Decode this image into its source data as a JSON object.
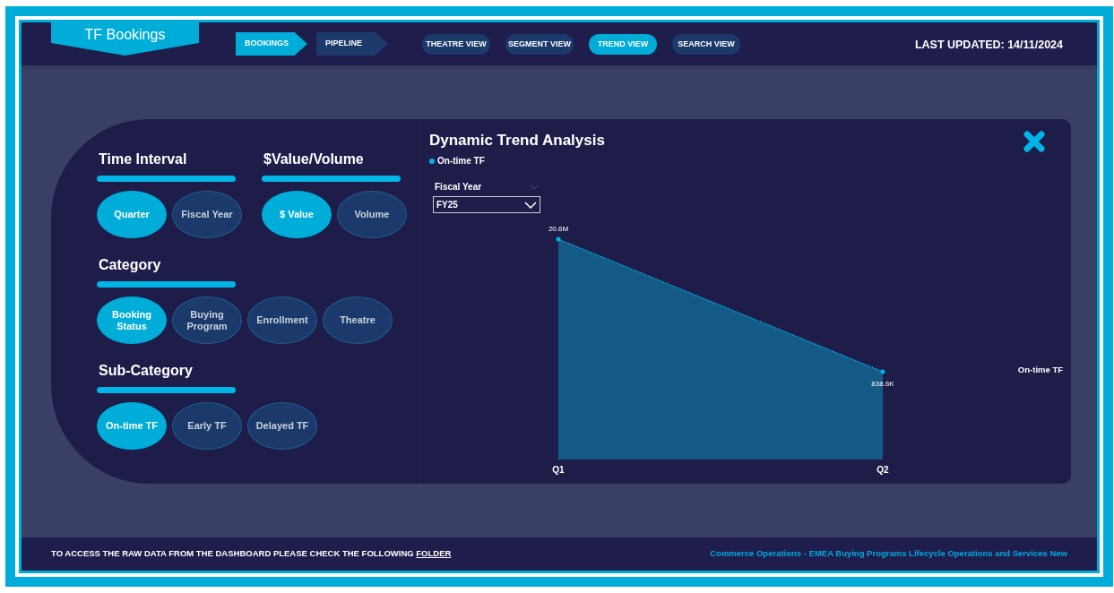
{
  "header": {
    "title": "TF Bookings",
    "nav": [
      {
        "label": "BOOKINGS",
        "selected": true
      },
      {
        "label": "PIPELINE",
        "selected": false
      }
    ],
    "views": [
      {
        "label": "THEATRE VIEW",
        "selected": false
      },
      {
        "label": "SEGMENT VIEW",
        "selected": false
      },
      {
        "label": "TREND VIEW",
        "selected": true
      },
      {
        "label": "SEARCH VIEW",
        "selected": false
      }
    ],
    "last_updated": "LAST UPDATED: 14/11/2024"
  },
  "slicers": [
    {
      "title": "Time Interval",
      "options": [
        {
          "label": "Quarter",
          "selected": true
        },
        {
          "label": "Fiscal Year",
          "selected": false
        }
      ]
    },
    {
      "title": "$Value/Volume",
      "options": [
        {
          "label": "$ Value",
          "selected": true
        },
        {
          "label": "Volume",
          "selected": false
        }
      ]
    },
    {
      "title": "Category",
      "options": [
        {
          "label": "Booking Status",
          "selected": true
        },
        {
          "label": "Buying Program",
          "selected": false
        },
        {
          "label": "Enrollment",
          "selected": false
        },
        {
          "label": "Theatre",
          "selected": false
        }
      ]
    },
    {
      "title": "Sub-Category",
      "options": [
        {
          "label": "On-time TF",
          "selected": true
        },
        {
          "label": "Early TF",
          "selected": false
        },
        {
          "label": "Delayed TF",
          "selected": false
        }
      ]
    }
  ],
  "chart_panel": {
    "title": "Dynamic Trend Analysis",
    "legend": [
      "On-time TF"
    ],
    "filter": {
      "label": "Fiscal Year",
      "value": "FY25"
    },
    "trend_chart": {
      "series_name": "On-time TF",
      "points": [
        {
          "category": "Q1",
          "value_label": "20.6M"
        },
        {
          "category": "Q2",
          "value_label": "838.6K"
        }
      ]
    }
  },
  "footer": {
    "notice": "TO ACCESS THE RAW DATA FROM THE DASHBOARD PLEASE CHECK THE FOLLOWING",
    "link": "FOLDER",
    "credit": "Commerce Operations - EMEA Buying Programs Lifecycle Operations and Services New"
  }
}
